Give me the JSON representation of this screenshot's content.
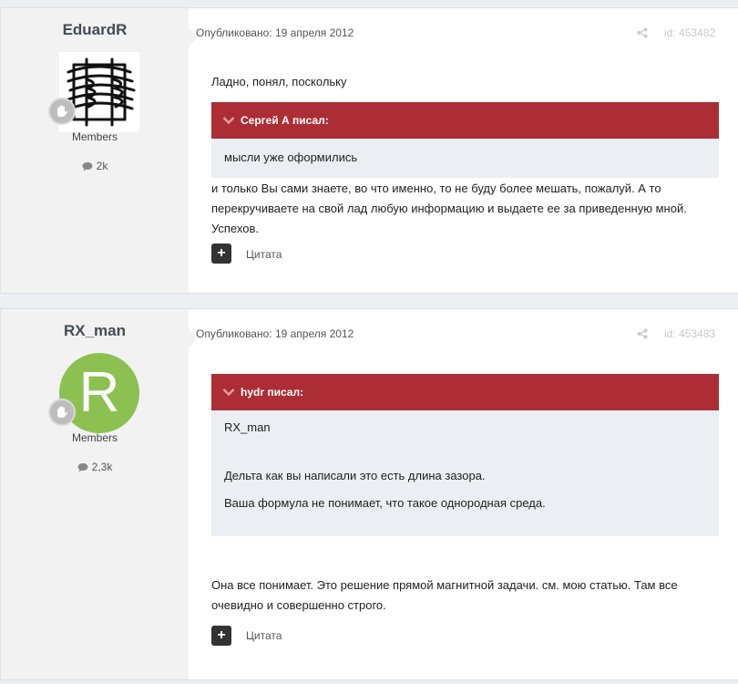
{
  "posts": [
    {
      "author": {
        "username": "EduardR",
        "group": "Members",
        "post_count": "2k",
        "avatar_type": "image",
        "avatar_desc": "coil-sketch"
      },
      "date": "Опубликовано: 19 апреля 2012",
      "post_id": "id: 453482",
      "intro_text": "Ладно, понял, поскольку",
      "quote": {
        "author": "Сергей А писал:",
        "lines": [
          "мысли уже оформились"
        ]
      },
      "body_text": "и только Вы сами знаете, во что именно, то не буду более мешать, пожалуй. А то перекручиваете на свой лад любую информацию и выдаете ее за приведенную мной. Успехов.",
      "quote_button": "Цитата"
    },
    {
      "author": {
        "username": "RX_man",
        "group": "Members",
        "post_count": "2,3k",
        "avatar_type": "letter",
        "avatar_letter": "R"
      },
      "date": "Опубликовано: 19 апреля 2012",
      "post_id": "id: 453483",
      "quote": {
        "author": "hydr писал:",
        "lines": [
          "RX_man",
          "Дельта как вы написали это есть длина зазора.",
          "Ваша формула не понимает, что такое однородная среда."
        ]
      },
      "body_text": "Она все понимает. Это решение прямой магнитной задачи. см. мою статью. Там все очевидно и совершенно строго.",
      "quote_button": "Цитата"
    }
  ],
  "colors": {
    "quote_header": "#ad2d36",
    "quote_body": "#ebeef2",
    "avatar_green": "#8cc152",
    "author_column": "#f2f2f2"
  },
  "icons": [
    "rank-badge-icon",
    "comment-icon",
    "share-icon",
    "chevron-down-icon",
    "plus-icon"
  ]
}
